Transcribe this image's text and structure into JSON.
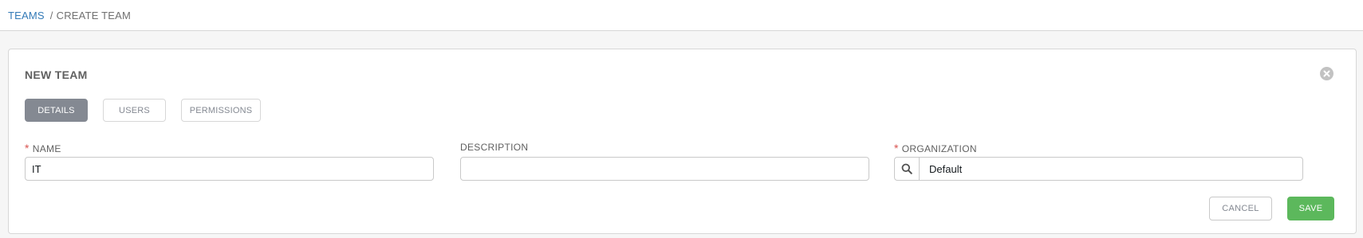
{
  "breadcrumb": {
    "parent": "TEAMS",
    "separator": "/",
    "current": "CREATE TEAM"
  },
  "panel": {
    "title": "NEW TEAM",
    "close_icon": "close-circle-icon"
  },
  "tabs": [
    {
      "label": "DETAILS",
      "active": true
    },
    {
      "label": "USERS",
      "active": false
    },
    {
      "label": "PERMISSIONS",
      "active": false
    }
  ],
  "form": {
    "required_marker": "*",
    "name": {
      "label": "NAME",
      "required": true,
      "value": "IT"
    },
    "description": {
      "label": "DESCRIPTION",
      "required": false,
      "value": ""
    },
    "organization": {
      "label": "ORGANIZATION",
      "required": true,
      "value": "Default",
      "icon": "search-icon"
    }
  },
  "actions": {
    "cancel_label": "CANCEL",
    "save_label": "SAVE"
  },
  "colors": {
    "link": "#337ab7",
    "active_tab": "#848992",
    "required": "#d9534f",
    "save": "#5cb85c"
  }
}
